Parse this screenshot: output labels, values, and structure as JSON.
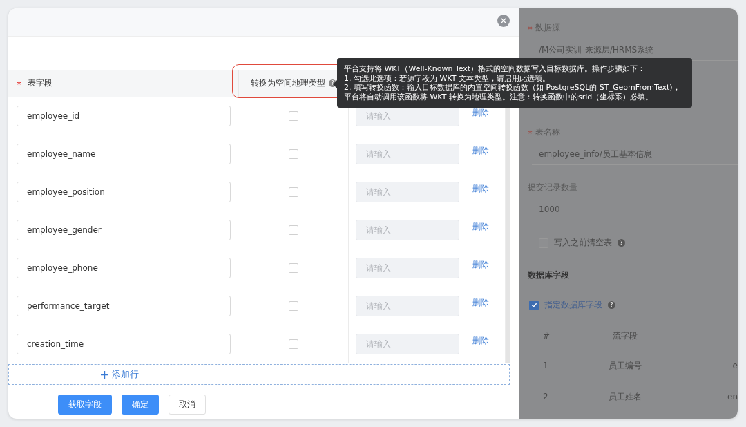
{
  "table": {
    "columns": [
      {
        "label": "表字段",
        "required": true,
        "highlighted": false
      },
      {
        "label": "转换为空间地理类型",
        "required": false,
        "help": "?",
        "highlighted": true
      }
    ],
    "rows": [
      {
        "field": "employee_id",
        "convert": false,
        "function_placeholder": "请输入",
        "action": "删除"
      },
      {
        "field": "employee_name",
        "convert": false,
        "function_placeholder": "请输入",
        "action": "删除"
      },
      {
        "field": "employee_position",
        "convert": false,
        "function_placeholder": "请输入",
        "action": "删除"
      },
      {
        "field": "employee_gender",
        "convert": false,
        "function_placeholder": "请输入",
        "action": "删除"
      },
      {
        "field": "employee_phone",
        "convert": false,
        "function_placeholder": "请输入",
        "action": "删除"
      },
      {
        "field": "performance_target",
        "convert": false,
        "function_placeholder": "请输入",
        "action": "删除"
      },
      {
        "field": "creation_time",
        "convert": false,
        "function_placeholder": "请输入",
        "action": "删除"
      }
    ]
  },
  "add_row": "添加行",
  "buttons": [
    {
      "label": "获取字段",
      "kind": "primary"
    },
    {
      "label": "确定",
      "kind": "primary"
    },
    {
      "label": "取消",
      "kind": "default"
    }
  ],
  "tooltip": {
    "lines": [
      "平台支持将 WKT（Well-Known Text）格式的空间数据写入目标数据库。操作步骤如下：",
      "1. 勾选此选项：若源字段为 WKT 文本类型，请启用此选项。",
      "2. 填写转换函数：输入目标数据库的内置空间转换函数（如 PostgreSQL的 ST_GeomFromText)，",
      "平台将自动调用该函数将 WKT 转换为地理类型。注意：转换函数中的srid（坐标系）必填。"
    ]
  },
  "side_panel": {
    "fields": [
      {
        "label": "数据源",
        "required": true,
        "value": "/M公司实训-来源层/HRMS系统"
      },
      {
        "label": "表名称",
        "required": true,
        "value": "employee_info/员工基本信息"
      },
      {
        "label": "提交记录数量",
        "required": false,
        "value": "1000"
      }
    ],
    "clear_table": {
      "label": "写入之前清空表",
      "checked": false,
      "help": "?"
    },
    "section_title": "数据库字段",
    "specify_fields": {
      "label": "指定数据库字段",
      "checked": true,
      "help": "?"
    },
    "columns": [
      "#",
      "流字段"
    ],
    "rows": [
      {
        "index": "1",
        "stream_field": "员工编号",
        "column_3": "e"
      },
      {
        "index": "2",
        "stream_field": "员工姓名",
        "column_3": "en"
      }
    ]
  }
}
